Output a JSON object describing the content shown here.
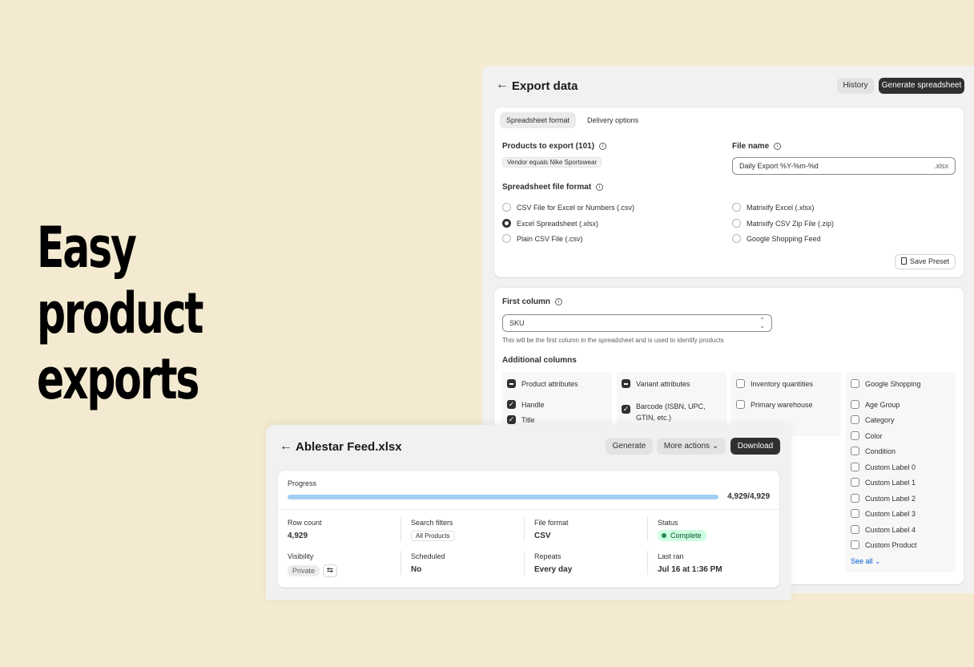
{
  "hero": {
    "line1": "Easy",
    "line2": "product",
    "line3": "exports"
  },
  "export": {
    "title": "Export data",
    "history_label": "History",
    "generate_label": "Generate spreadsheet",
    "tabs": [
      "Spreadsheet format",
      "Delivery options"
    ],
    "products_label": "Products to export (101)",
    "filter_chip": "Vendor equals Nike Sportswear",
    "file_name_label": "File name",
    "file_name_value": "Daily Export %Y-%m-%d",
    "file_ext": ".xlsx",
    "format_label": "Spreadsheet file format",
    "formats_left": [
      "CSV File for Excel or Numbers (.csv)",
      "Excel Spreadsheet (.xlsx)",
      "Plain CSV File (.csv)"
    ],
    "formats_right": [
      "Matrixify Excel (.xlsx)",
      "Matrixify CSV Zip File (.zip)",
      "Google Shopping Feed"
    ],
    "selected_format": "Excel Spreadsheet (.xlsx)",
    "save_preset_label": "Save Preset",
    "first_column_label": "First column",
    "first_column_value": "SKU",
    "first_column_help": "This will be the first column in the spreadsheet and is used to identify products",
    "additional_label": "Additional columns",
    "col_product": {
      "header": "Product attributes",
      "items": [
        "Handle",
        "Title"
      ]
    },
    "col_variant": {
      "header": "Variant attributes",
      "items": [
        "Barcode (ISBN, UPC,",
        "GTIN, etc.)"
      ]
    },
    "col_inventory": {
      "header": "Inventory quantities",
      "items": [
        "Primary warehouse"
      ]
    },
    "col_google": {
      "header": "Google Shopping",
      "items": [
        "Age Group",
        "Category",
        "Color",
        "Condition",
        "Custom Label 0",
        "Custom Label 1",
        "Custom Label 2",
        "Custom Label 3",
        "Custom Label 4",
        "Custom Product"
      ]
    },
    "see_all_label": "See all"
  },
  "feed": {
    "title": "Ablestar Feed.xlsx",
    "generate_label": "Generate",
    "more_actions_label": "More actions",
    "download_label": "Download",
    "progress_label": "Progress",
    "progress_text": "4,929/4,929",
    "progress_fraction": 1.0,
    "row_count_label": "Row count",
    "row_count_value": "4,929",
    "search_filters_label": "Search filters",
    "search_filters_value": "All Products",
    "file_format_label": "File format",
    "file_format_value": "CSV",
    "status_label": "Status",
    "status_value": "Complete",
    "visibility_label": "Visibility",
    "visibility_value": "Private",
    "scheduled_label": "Scheduled",
    "scheduled_value": "No",
    "repeats_label": "Repeats",
    "repeats_value": "Every day",
    "last_ran_label": "Last ran",
    "last_ran_value": "Jul 16 at 1:36 PM"
  }
}
